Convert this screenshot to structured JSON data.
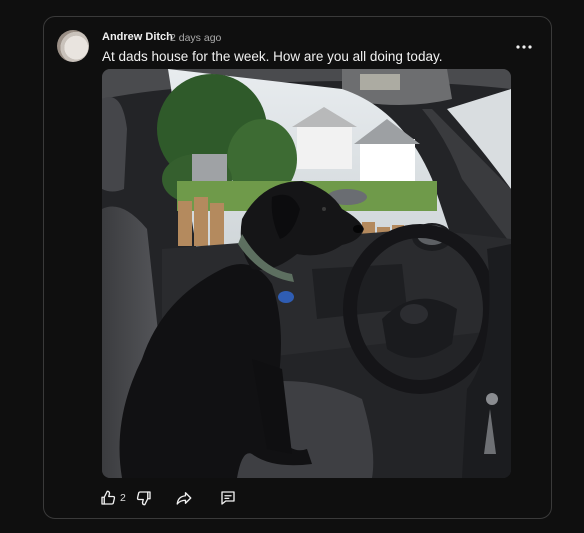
{
  "post": {
    "author": "Andrew Ditch",
    "time_ago": "2 days ago",
    "text": "At dads house for the week. How are you all doing today.",
    "like_count": "2"
  },
  "icons": {
    "more": "more-vertical-dots-icon",
    "like": "thumbs-up-icon",
    "dislike": "thumbs-down-icon",
    "share": "share-arrow-icon",
    "comment": "comment-icon"
  },
  "colors": {
    "background": "#0f0f0f",
    "card_border": "#3a3a3a",
    "text_primary": "#f1f1f1",
    "text_secondary": "#aaaaaa"
  }
}
